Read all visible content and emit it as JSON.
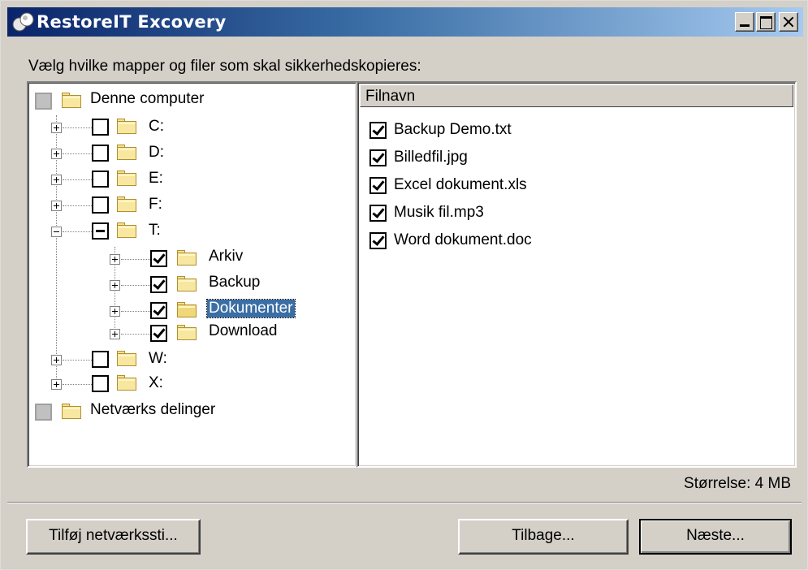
{
  "window": {
    "title": "RestoreIT Excovery",
    "controls": [
      "minimize",
      "maximize",
      "close"
    ]
  },
  "instruction": "Vælg hvilke mapper og filer som skal sikkerhedskopieres:",
  "tree": {
    "items": [
      {
        "label": "Denne computer",
        "state": "grey",
        "expander": null
      },
      {
        "label": "C:",
        "state": "unchecked",
        "expander": "plus"
      },
      {
        "label": "D:",
        "state": "unchecked",
        "expander": "plus"
      },
      {
        "label": "E:",
        "state": "unchecked",
        "expander": "plus"
      },
      {
        "label": "F:",
        "state": "unchecked",
        "expander": "plus"
      },
      {
        "label": "T:",
        "state": "partial",
        "expander": "minus"
      },
      {
        "label": "Arkiv",
        "state": "checked",
        "expander": "plus"
      },
      {
        "label": "Backup",
        "state": "checked",
        "expander": "plus"
      },
      {
        "label": "Dokumenter",
        "state": "checked",
        "expander": "plus",
        "selected": true
      },
      {
        "label": "Download",
        "state": "checked",
        "expander": "plus"
      },
      {
        "label": "W:",
        "state": "unchecked",
        "expander": "plus"
      },
      {
        "label": "X:",
        "state": "unchecked",
        "expander": "plus"
      },
      {
        "label": "Netværks delinger",
        "state": "grey",
        "expander": null
      }
    ]
  },
  "files": {
    "column_header": "Filnavn",
    "items": [
      {
        "name": "Backup Demo.txt",
        "checked": true
      },
      {
        "name": "Billedfil.jpg",
        "checked": true
      },
      {
        "name": "Excel dokument.xls",
        "checked": true
      },
      {
        "name": "Musik fil.mp3",
        "checked": true
      },
      {
        "name": "Word dokument.doc",
        "checked": true
      }
    ]
  },
  "size_text": "Størrelse: 4 MB",
  "buttons": {
    "add_network_path": "Tilføj netværkssti...",
    "back": "Tilbage...",
    "next": "Næste..."
  },
  "colors": {
    "titlebar_start": "#0a246a",
    "titlebar_end": "#a6caf0",
    "selection": "#3a6ea5",
    "dialog_bg": "#d4d0c8"
  }
}
